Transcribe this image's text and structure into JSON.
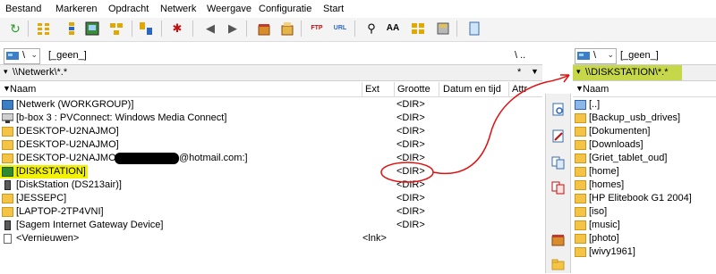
{
  "menu": [
    "Bestand",
    "Markeren",
    "Opdracht",
    "Netwerk",
    "Weergave",
    "Configuratie",
    "Start"
  ],
  "toolbar": {
    "icons": [
      "refresh-icon",
      "brief-view-icon",
      "detail-view-icon",
      "thumbnail-view-icon",
      "tree-view-icon",
      "compare-icon",
      "select-all-icon",
      "back-icon",
      "forward-icon",
      "pack-icon",
      "unpack-icon",
      "ftp-icon",
      "url-icon",
      "search-icon",
      "multi-rename-icon",
      "sync-dirs-icon",
      "disk-icon",
      "notepad-icon"
    ],
    "ftp_label": "FTP",
    "url_label": "URL"
  },
  "left_panel": {
    "drive_label": "\\",
    "volume_label": "[_geen_]",
    "path_right": "\\  ..",
    "path": "\\\\Netwerk\\*.*",
    "path_filter": "*",
    "columns": {
      "name": "Naam",
      "ext": "Ext",
      "size": "Grootte",
      "date": "Datum en tijd",
      "attr": "Attr"
    },
    "rows": [
      {
        "icon": "network-icon",
        "name": "[Netwerk (WORKGROUP)]",
        "ext": "",
        "size": "<DIR>"
      },
      {
        "icon": "media-server-icon",
        "name": "[b-box 3 : PVConnect: Windows Media Connect]",
        "ext": "",
        "size": "<DIR>"
      },
      {
        "icon": "folder-icon",
        "name": "[DESKTOP-U2NAJMO]",
        "ext": "",
        "size": "<DIR>"
      },
      {
        "icon": "folder-icon",
        "name": "[DESKTOP-U2NAJMO]",
        "ext": "",
        "size": "<DIR>"
      },
      {
        "icon": "folder-icon",
        "name": "[DESKTOP-U2NAJMO:",
        "suffix": "@hotmail.com:]",
        "ext": "",
        "size": "<DIR>"
      },
      {
        "icon": "nas-icon",
        "name": "[DISKSTATION]",
        "ext": "",
        "size": "<DIR>"
      },
      {
        "icon": "computer-icon",
        "name": "[DiskStation (DS213air)]",
        "ext": "",
        "size": "<DIR>"
      },
      {
        "icon": "folder-icon",
        "name": "[JESSEPC]",
        "ext": "",
        "size": "<DIR>"
      },
      {
        "icon": "folder-icon",
        "name": "[LAPTOP-2TP4VNI]",
        "ext": "",
        "size": "<DIR>"
      },
      {
        "icon": "computer-icon",
        "name": "[Sagem Internet Gateway Device]",
        "ext": "",
        "size": "<DIR>"
      },
      {
        "icon": "file-icon",
        "name": "<Vernieuwen>",
        "ext": "<lnk>",
        "size": ""
      }
    ]
  },
  "right_panel": {
    "drive_label": "\\",
    "volume_label": "[_geen_]",
    "path": "\\\\DISKSTATION\\*.*",
    "columns": {
      "name": "Naam"
    },
    "rows": [
      {
        "icon": "up-icon",
        "name": "[..]"
      },
      {
        "icon": "folder-icon",
        "name": "[Backup_usb_drives]"
      },
      {
        "icon": "folder-icon",
        "name": "[Dokumenten]"
      },
      {
        "icon": "folder-icon",
        "name": "[Downloads]"
      },
      {
        "icon": "folder-icon",
        "name": "[Griet_tablet_oud]"
      },
      {
        "icon": "folder-icon",
        "name": "[home]"
      },
      {
        "icon": "folder-icon",
        "name": "[homes]"
      },
      {
        "icon": "folder-icon",
        "name": "[HP Elitebook G1 2004]"
      },
      {
        "icon": "folder-icon",
        "name": "[iso]"
      },
      {
        "icon": "folder-icon",
        "name": "[music]"
      },
      {
        "icon": "folder-icon",
        "name": "[photo]"
      },
      {
        "icon": "folder-icon",
        "name": "[wivy1961]"
      }
    ]
  },
  "middle_strip_icons": [
    "view-icon",
    "edit-icon",
    "copy-icon",
    "move-icon",
    "pack-icon",
    "new-folder-icon"
  ],
  "colors": {
    "highlight_yellow": "#f2f200",
    "highlight_olive": "#c6d84a",
    "annotation_red": "#e01010",
    "redaction": "#000000"
  }
}
